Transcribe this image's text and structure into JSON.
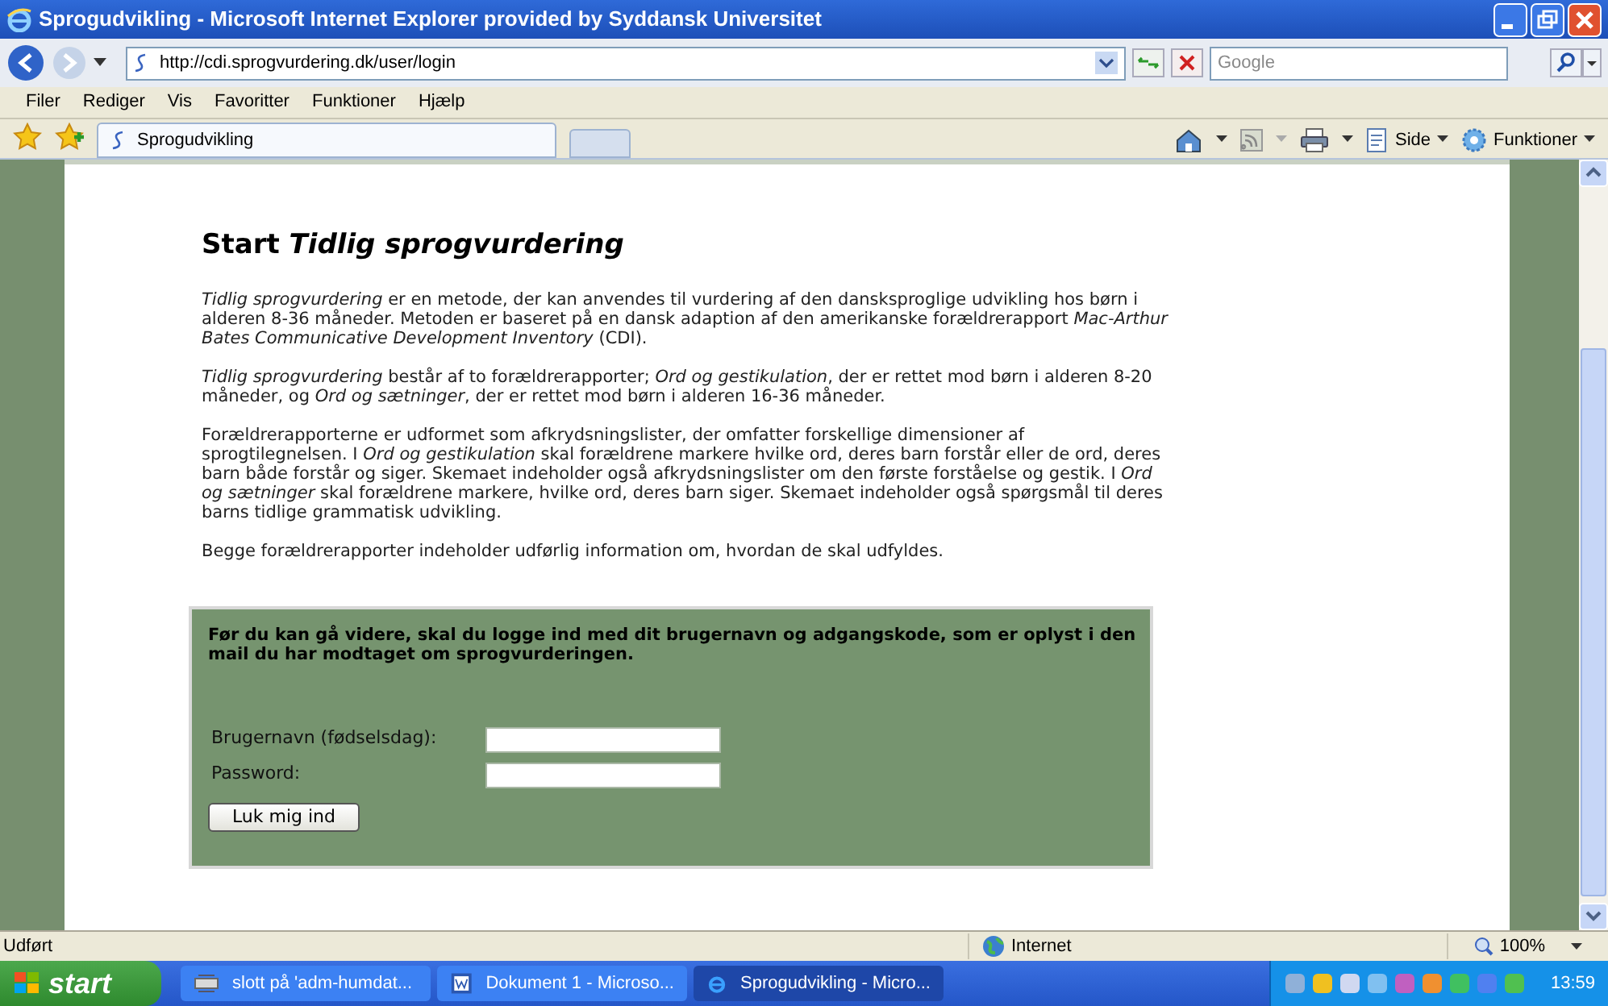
{
  "window": {
    "title": "Sprogudvikling - Microsoft Internet Explorer provided by Syddansk Universitet"
  },
  "address_bar": {
    "url": "http://cdi.sprogvurdering.dk/user/login",
    "search_placeholder": "Google"
  },
  "menu": [
    "Filer",
    "Rediger",
    "Vis",
    "Favoritter",
    "Funktioner",
    "Hjælp"
  ],
  "tabs": [
    {
      "label": "Sprogudvikling",
      "selected": true
    }
  ],
  "command_bar": [
    {
      "label": "Side"
    },
    {
      "label": "Funktioner"
    }
  ],
  "page": {
    "heading": "Start *Tidlig sprogvurdering*",
    "paragraphs": [
      "*Tidlig sprogvurdering* er en metode, der kan anvendes til vurdering af den dansksproglige udvikling hos børn i alderen 8-36 måneder. Metoden er baseret på en dansk adaption af den amerikanske forældrerapport *Mac-Arthur Bates Communicative Development Inventory* (CDI).",
      "*Tidlig sprogvurdering* består af to forældrerapporter; *Ord og gestikulation*, der er rettet mod børn i alderen 8-20 måneder, og *Ord og sætninger*, der er rettet mod børn i alderen 16-36 måneder.",
      "Forældrerapporterne er udformet som afkrydsningslister, der omfatter forskellige dimensioner af sprogtilegnelsen. I *Ord og gestikulation* skal forældrene markere hvilke ord, deres barn forstår eller de ord, deres barn både forstår og siger. Skemaet indeholder også afkrydsningslister om den første forståelse og gestik. I *Ord og sætninger* skal forældrene markere, hvilke ord, deres barn siger. Skemaet indeholder også spørgsmål til deres barns tidlige grammatisk udvikling.",
      "Begge forældrerapporter indeholder udførlig information om, hvordan de skal udfyldes."
    ],
    "login": {
      "intro": "Før du kan gå videre, skal du logge ind med dit brugernavn og adgangskode, som er oplyst i den mail du har modtaget om sprogvurderingen.",
      "fields": [
        {
          "label": "Brugernavn (fødselsdag):"
        },
        {
          "label": "Password:"
        }
      ],
      "button": "Luk mig ind"
    }
  },
  "status_bar": {
    "text": "Udført",
    "zone": "Internet",
    "zoom": "100%"
  },
  "taskbar": {
    "start": "start",
    "tasks": [
      {
        "label": "slott på 'adm-humdat...",
        "selected": false
      },
      {
        "label": "Dokument 1 - Microso...",
        "selected": false
      },
      {
        "label": "Sprogudvikling - Micro...",
        "selected": true
      }
    ],
    "clock": "13:59"
  }
}
